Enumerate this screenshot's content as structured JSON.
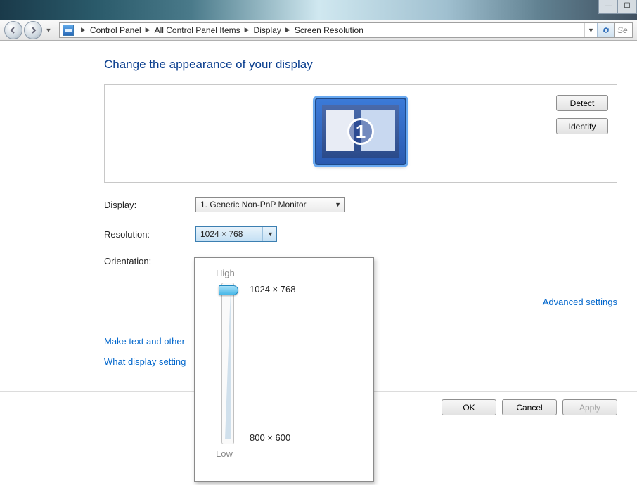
{
  "breadcrumb": {
    "items": [
      "Control Panel",
      "All Control Panel Items",
      "Display",
      "Screen Resolution"
    ]
  },
  "search": {
    "placeholder": "Se"
  },
  "heading": "Change the appearance of your display",
  "monitor_number": "1",
  "buttons": {
    "detect": "Detect",
    "identify": "Identify",
    "ok": "OK",
    "cancel": "Cancel",
    "apply": "Apply"
  },
  "labels": {
    "display": "Display:",
    "resolution": "Resolution:",
    "orientation": "Orientation:"
  },
  "display_value": "1. Generic Non-PnP Monitor",
  "resolution_value": "1024 × 768",
  "advanced_link": "Advanced settings",
  "links": {
    "text_size": "Make text and other",
    "what_settings": "What display setting"
  },
  "popup": {
    "high": "High",
    "low": "Low",
    "val_high": "1024 × 768",
    "val_low": "800 × 600"
  }
}
